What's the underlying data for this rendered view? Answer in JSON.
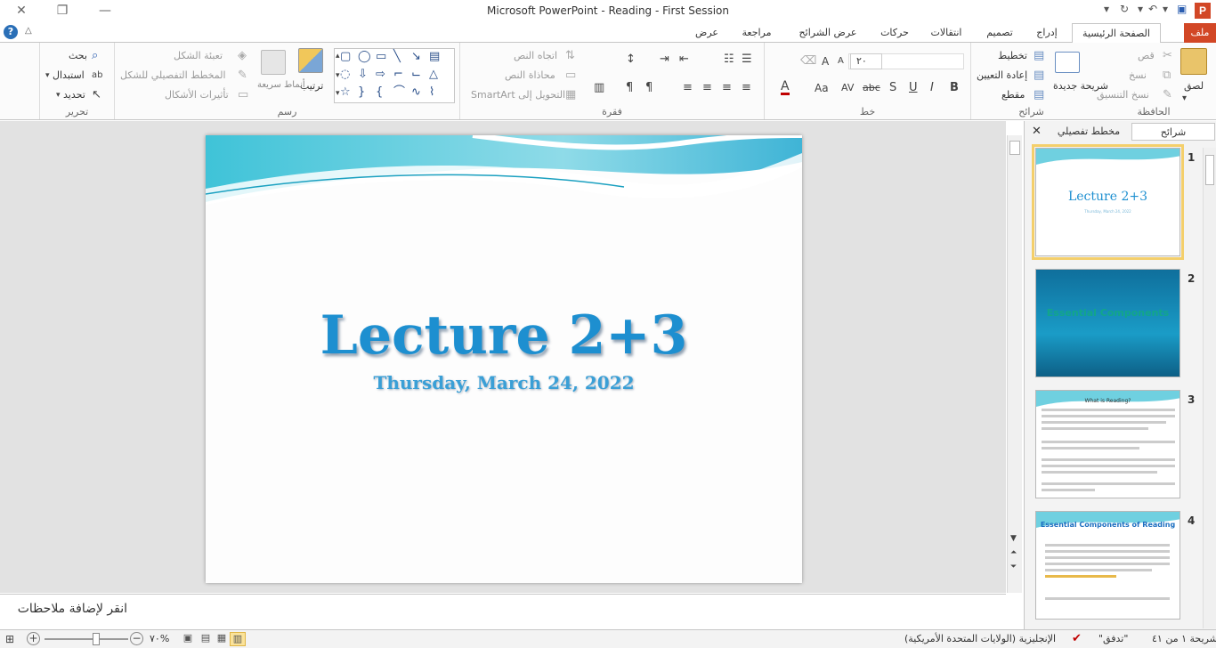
{
  "window": {
    "title": "Microsoft PowerPoint  -  Reading  - First Session",
    "close_glyph": "✕",
    "restore_glyph": "❐",
    "minimize_glyph": "—",
    "logo": "P"
  },
  "tabs": [
    {
      "label": "ملف"
    },
    {
      "label": "الصفحة الرئيسية"
    },
    {
      "label": "إدراج"
    },
    {
      "label": "تصميم"
    },
    {
      "label": "انتقالات"
    },
    {
      "label": "حركات"
    },
    {
      "label": "عرض الشرائح"
    },
    {
      "label": "مراجعة"
    },
    {
      "label": "عرض"
    }
  ],
  "ribbon": {
    "clipboard": {
      "label": "الحافظة",
      "paste": "لصق",
      "cut": "قص",
      "copy": "نسخ",
      "format_painter": "نسخ التنسيق"
    },
    "slides": {
      "label": "شرائح",
      "new_slide": "شريحة جديدة",
      "layout": "تخطيط",
      "reset": "إعادة التعيين",
      "section": "مقطع"
    },
    "font": {
      "label": "خط",
      "size": "٢٠",
      "bold": "B",
      "italic": "I",
      "underline": "U",
      "shadow": "S",
      "strike": "abc",
      "spacing": "AV",
      "case": "Aa",
      "color": "A",
      "grow": "A",
      "shrink": "A"
    },
    "paragraph": {
      "label": "فقرة",
      "text_direction": "اتجاه النص",
      "align_text": "محاذاة النص",
      "smartart": "التحويل إلى SmartArt"
    },
    "drawing": {
      "label": "رسم",
      "arrange": "ترتيب",
      "quick_styles": "أنماط سريعة",
      "shape_fill": "تعبئة الشكل",
      "shape_outline": "المخطط التفصيلي للشكل",
      "shape_effects": "تأثيرات الأشكال"
    },
    "editing": {
      "label": "تحرير",
      "find": "بحث",
      "replace": "استبدال",
      "select": "تحديد"
    }
  },
  "slide": {
    "title": "Lecture 2+3",
    "subtitle": "Thursday,  March 24, 2022"
  },
  "notes": {
    "placeholder": "انقر لإضافة ملاحظات"
  },
  "panel": {
    "tab_slides": "شرائح",
    "tab_outline": "مخطط تفصيلي",
    "close": "✕",
    "thumbnails": [
      {
        "num": "1",
        "title": "Lecture 2+3",
        "subtitle": "Thursday, March 24, 2022"
      },
      {
        "num": "2",
        "title": "Essential Components"
      },
      {
        "num": "3",
        "title": "What is Reading?"
      },
      {
        "num": "4",
        "title": "Essential Components of Reading"
      }
    ]
  },
  "status": {
    "slide_info": "شريحة ١ من ٤١",
    "theme": "\"تدفق\"",
    "language": "الإنجليزية (الولايات المتحدة الأمريكية)",
    "zoom": "%٧٠"
  },
  "colors": {
    "accent": "#d24726",
    "title_blue": "#1d8fd0",
    "selection": "#f4cf6b"
  }
}
